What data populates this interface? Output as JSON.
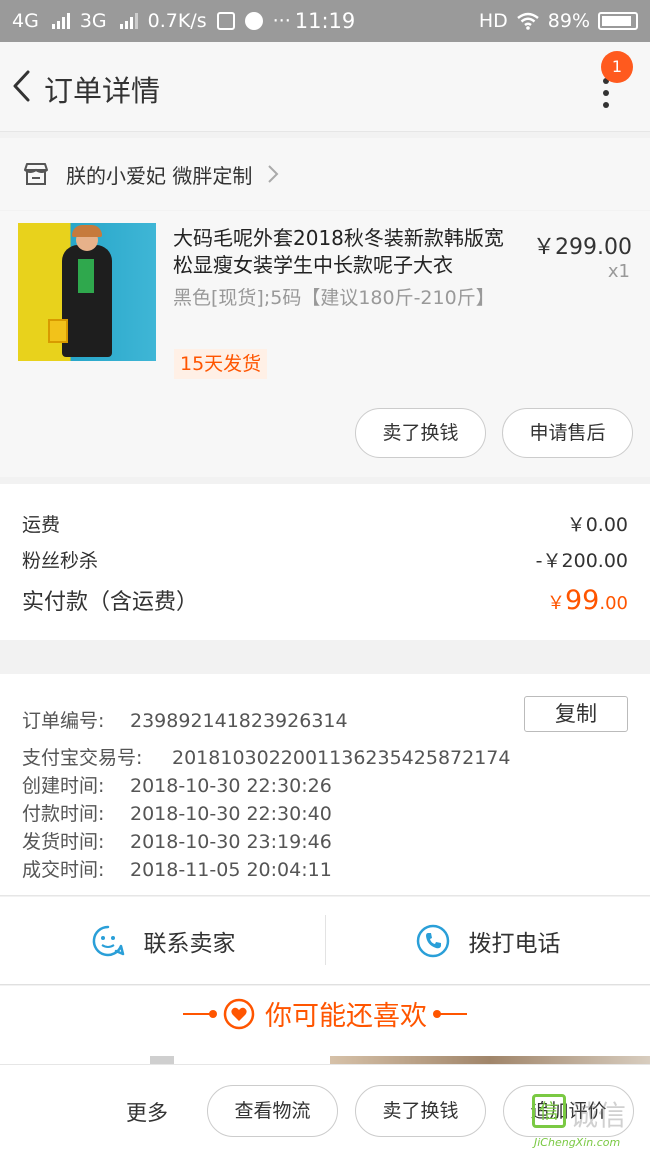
{
  "status_bar": {
    "network_1": "4G",
    "network_2": "3G",
    "speed": "0.7K/s",
    "time": "11:19",
    "hd": "HD",
    "battery": "89%"
  },
  "nav": {
    "title": "订单详情",
    "badge_count": "1",
    "icons": [
      "back-arrow-icon",
      "more-vertical-icon"
    ]
  },
  "shop": {
    "name": "朕的小爱妃 微胖定制",
    "icon": "store-icon"
  },
  "product": {
    "title": "大码毛呢外套2018秋冬装新款韩版宽松显瘦女装学生中长款呢子大衣",
    "spec": "黑色[现货];5码【建议180斤-210斤】",
    "ship_tag": "15天发货",
    "price": "￥299.00",
    "qty": "x1",
    "actions": [
      "卖了换钱",
      "申请售后"
    ]
  },
  "summary": {
    "shipping_label": "运费",
    "shipping_value": "￥0.00",
    "discount_label": "粉丝秒杀",
    "discount_value": "-￥200.00",
    "paid_label": "实付款（含运费）",
    "paid_symbol": "￥",
    "paid_int": "99",
    "paid_dec": ".00",
    "accent_color": "#ff5500"
  },
  "order_info": {
    "order_no_label": "订单编号:",
    "order_no": "239892141823926314",
    "copy_label": "复制",
    "alipay_label": "支付宝交易号:",
    "alipay_no": "2018103022001136235425872174",
    "created_label": "创建时间:",
    "created": "2018-10-30 22:30:26",
    "paid_label": "付款时间:",
    "paid": "2018-10-30 22:30:40",
    "shipped_label": "发货时间:",
    "shipped": "2018-10-30 23:19:46",
    "done_label": "成交时间:",
    "done": "2018-11-05 20:04:11"
  },
  "contact": {
    "seller_label": "联系卖家",
    "phone_label": "拨打电话",
    "icons": [
      "chat-bubble-icon",
      "phone-icon"
    ]
  },
  "recommend": {
    "title": "你可能还喜欢",
    "icon": "heart-icon"
  },
  "bottom_bar": {
    "more": "更多",
    "buttons": [
      "查看物流",
      "卖了换钱",
      "追加评价"
    ]
  },
  "watermark": {
    "text": "诚信",
    "sub": "JiChengXin.com"
  }
}
